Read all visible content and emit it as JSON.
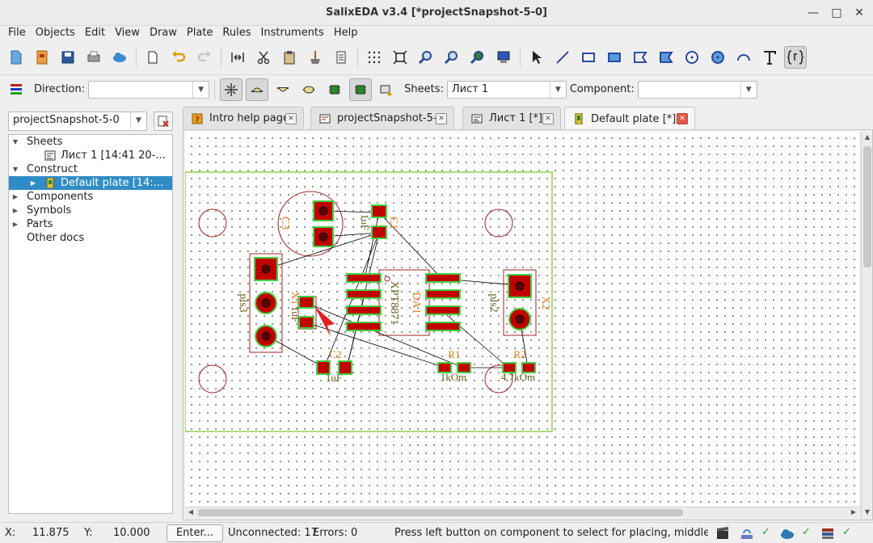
{
  "window": {
    "title": "SalixEDA v3.4 [*projectSnapshot-5-0]",
    "minimize_glyph": "—",
    "maximize_glyph": "□",
    "close_glyph": "✕"
  },
  "menu": {
    "file": "File",
    "objects": "Objects",
    "edit": "Edit",
    "view": "View",
    "draw": "Draw",
    "plate": "Plate",
    "rules": "Rules",
    "instruments": "Instruments",
    "help": "Help"
  },
  "toolbar2": {
    "direction_label": "Direction:",
    "direction_value": "",
    "sheets_label": "Sheets:",
    "sheets_value": "Лист 1",
    "component_label": "Component:",
    "component_value": ""
  },
  "project": {
    "selector_value": "projectSnapshot-5-0",
    "tree": {
      "sheets": "Sheets",
      "sheet1": "Лист 1 [14:41 20-...",
      "construct": "Construct",
      "default_plate": "Default plate [14:...",
      "components": "Components",
      "symbols": "Symbols",
      "parts": "Parts",
      "other_docs": "Other docs"
    }
  },
  "tabs": {
    "intro": "Intro help page",
    "project": "projectSnapshot-5-0",
    "sheet": "Лист 1 [*]",
    "plate": "Default plate [*]"
  },
  "pcb": {
    "labels": {
      "c3": "C3",
      "c3_value": "1uF",
      "c1": "C1",
      "c2": "C2",
      "c2_value": "1uF",
      "x1": "X1",
      "x1_value": "1uF",
      "pls3": "pls3",
      "pls2": "pls2",
      "x2": "X2",
      "da1": "DA1",
      "chip": "XPT8871",
      "r1": "R1",
      "r1_value": "1kOm",
      "r2": "R2",
      "r2_value": "4.7kOm"
    },
    "colors": {
      "board_outline": "#8ed24a",
      "pad_fill": "#c00000",
      "pad_border": "#44d044",
      "silkscreen": "#a02020",
      "ref_label": "#e07a1a",
      "value_label": "#6a5a18",
      "ratsnest": "#000000"
    }
  },
  "status": {
    "x_label": "X:",
    "x_value": "11.875",
    "y_label": "Y:",
    "y_value": "10.000",
    "enter_button": "Enter...",
    "unconnected": "Unconnected: 17",
    "errors": "Errors: 0",
    "hint": "Press left button on component to select for placing, middle buttc",
    "check": "✓"
  }
}
